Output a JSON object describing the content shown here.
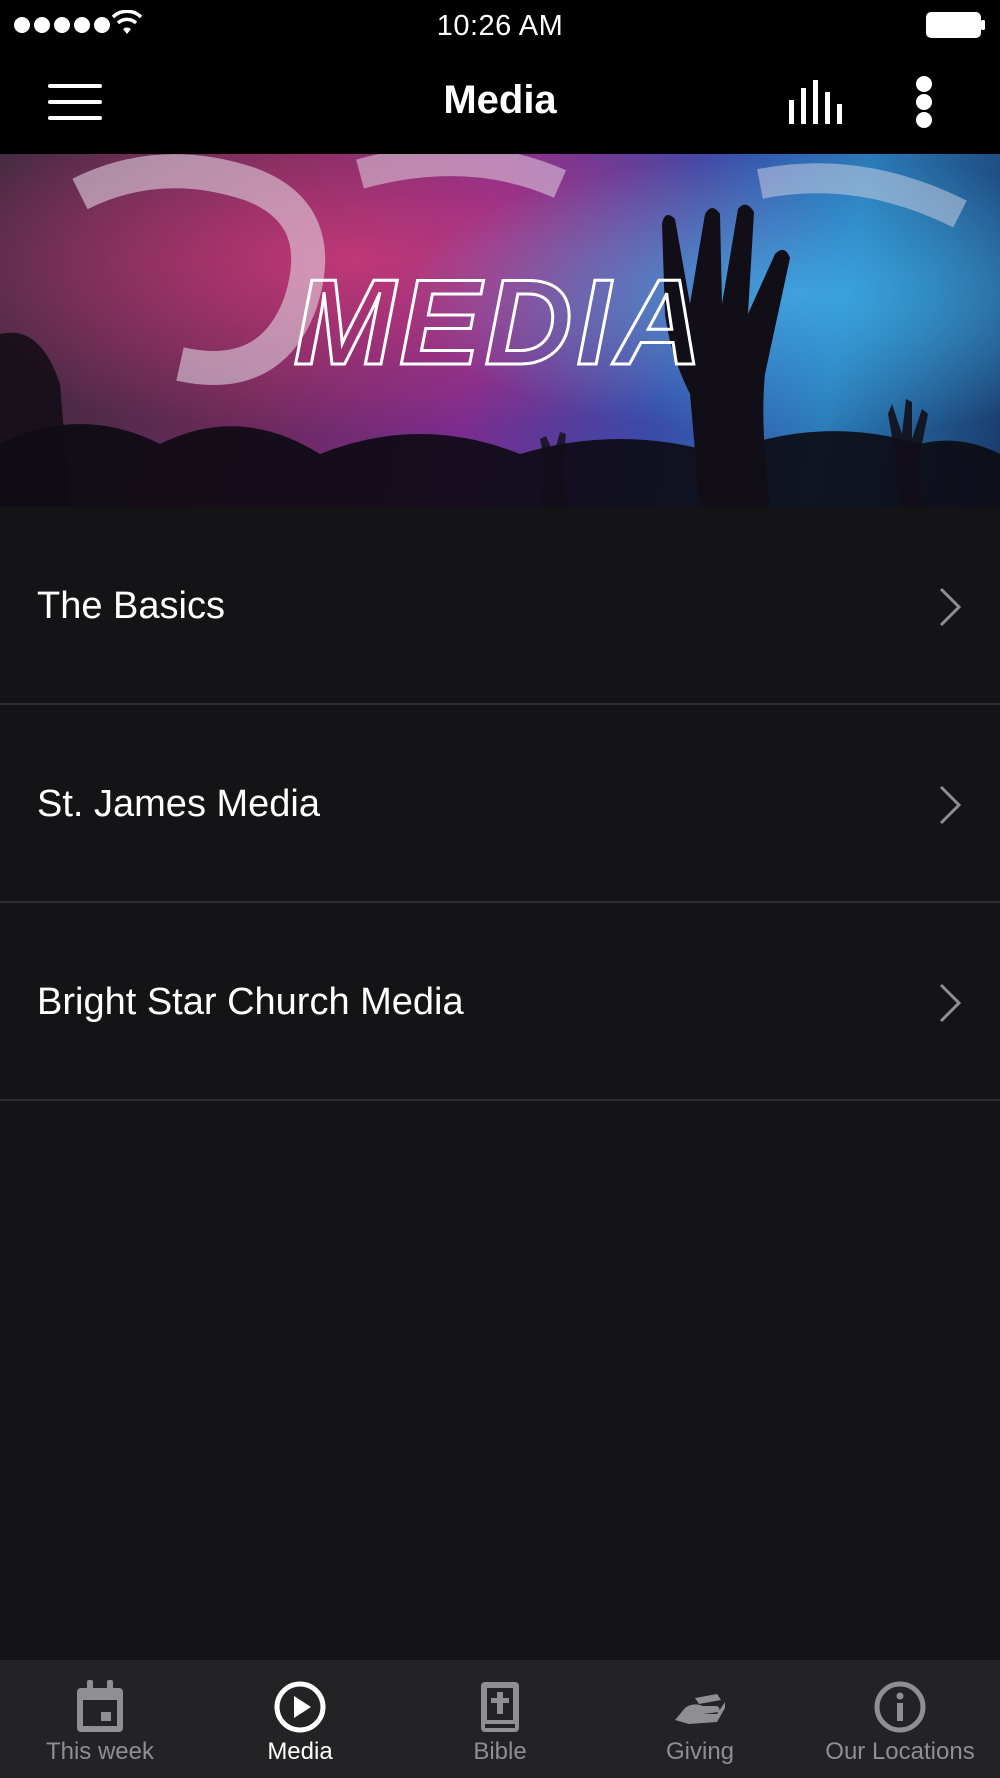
{
  "status_bar": {
    "time": "10:26 AM"
  },
  "nav": {
    "title": "Media",
    "menu_icon": "hamburger-menu-icon",
    "audio_icon": "audio-bars-icon",
    "more_icon": "vertical-dots-icon"
  },
  "hero": {
    "title": "MEDIA"
  },
  "list": {
    "items": [
      {
        "label": "The Basics"
      },
      {
        "label": "St. James Media"
      },
      {
        "label": "Bright Star Church Media"
      }
    ]
  },
  "tabs": [
    {
      "label": "This week",
      "icon": "calendar-icon",
      "active": false
    },
    {
      "label": "Media",
      "icon": "play-circle-icon",
      "active": true
    },
    {
      "label": "Bible",
      "icon": "bible-icon",
      "active": false
    },
    {
      "label": "Giving",
      "icon": "giving-hand-icon",
      "active": false
    },
    {
      "label": "Our Locations",
      "icon": "info-icon",
      "active": false
    }
  ],
  "colors": {
    "background": "#141416",
    "bar": "#000000",
    "tab_bar": "#232325",
    "tab_inactive": "#8e8e93",
    "tab_active": "#ffffff",
    "divider": "#2e2e31"
  }
}
